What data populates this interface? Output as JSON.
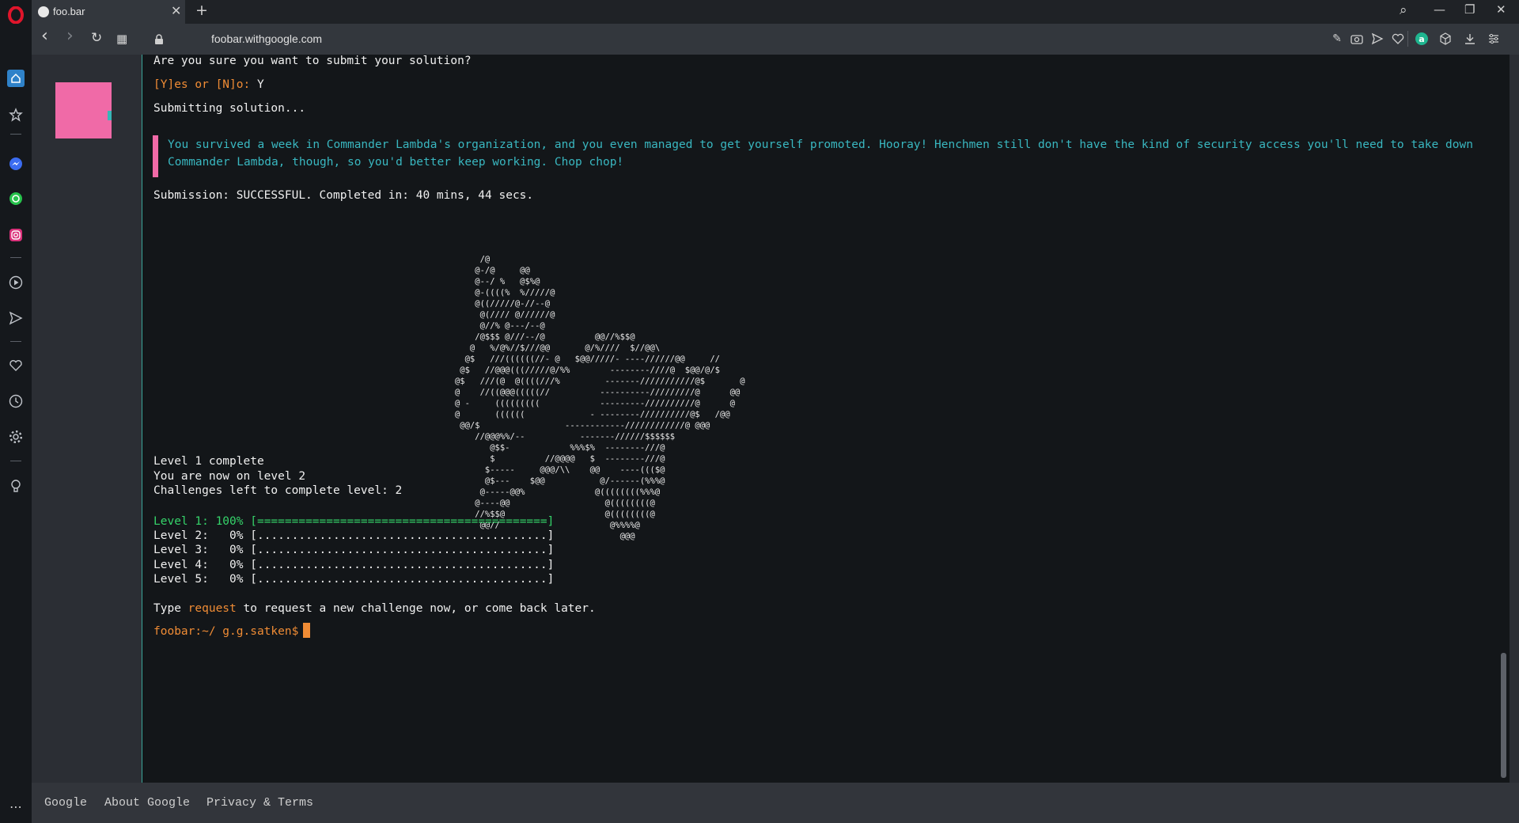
{
  "browser": {
    "tab_title": "foo.bar",
    "tab_close": "✕",
    "new_tab": "+",
    "url": "foobar.withgoogle.com",
    "search_icon": "⌕",
    "win_min": "—",
    "win_restore": "❐",
    "win_close": "✕",
    "back": "‹",
    "forward": "›",
    "reload": "↻",
    "tabs_grid": "▦",
    "colors": {
      "sidebar": "#15181c",
      "toolbar": "#33373d",
      "accent_opera": "#e0152b"
    }
  },
  "sidebar": {
    "icons": [
      "home-icon",
      "star-icon",
      "messenger-icon",
      "whatsapp-icon",
      "instagram-icon",
      "play-icon",
      "send-icon",
      "heart-icon",
      "history-icon",
      "settings-icon",
      "bulb-icon",
      "more-icon"
    ]
  },
  "terminal": {
    "confirm_prompt": "Are you sure you want to submit your solution?",
    "yn_prompt": "[Y]es or [N]o:",
    "yn_answer": "Y",
    "submitting": "Submitting solution...",
    "message_line1": "You survived a week in Commander Lambda's organization, and you even managed to get yourself promoted. Hooray! Henchmen still don't have the kind of security access you'll need to take down",
    "message_line2": "Commander Lambda, though, so you'd better keep working. Chop chop!",
    "submission": "Submission: SUCCESSFUL. Completed in: 40 mins, 44 secs.",
    "level_complete": "Level 1 complete",
    "now_on_level": "You are now on level 2",
    "challenges_left": "Challenges left to complete level: 2",
    "progress": [
      {
        "label": "Level 1: 100%",
        "bar": "[==========================================]",
        "percent": 100
      },
      {
        "label": "Level 2:   0%",
        "bar": "[..........................................]",
        "percent": 0
      },
      {
        "label": "Level 3:   0%",
        "bar": "[..........................................]",
        "percent": 0
      },
      {
        "label": "Level 4:   0%",
        "bar": "[..........................................]",
        "percent": 0
      },
      {
        "label": "Level 5:   0%",
        "bar": "[..........................................]",
        "percent": 0
      }
    ],
    "type_prefix": "Type",
    "type_keyword": "request",
    "type_suffix": "to request a new challenge now, or come back later.",
    "shell_prompt": "foobar:~/ g.g.satken$",
    "colors": {
      "accent": "#f08c35",
      "quote_text": "#39b7c0",
      "quote_bar": "#f06aa7",
      "progress_done": "#35d46a"
    }
  },
  "footer": {
    "links": [
      "Google",
      "About Google",
      "Privacy & Terms"
    ]
  }
}
